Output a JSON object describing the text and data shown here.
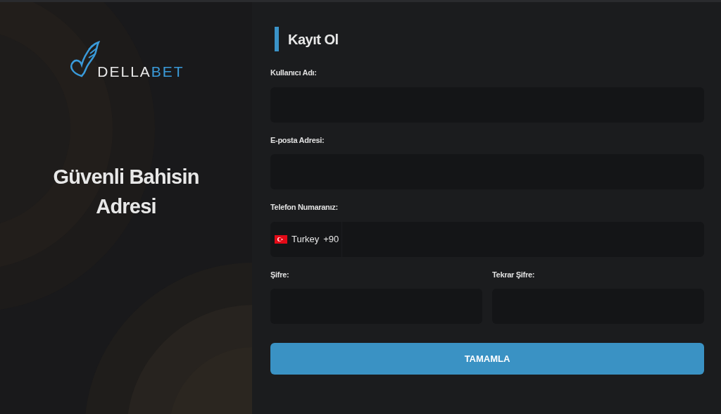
{
  "promo": {
    "logo": [
      "DELLA",
      "BET"
    ],
    "tagline": "Güvenli Bahisin Adresi"
  },
  "form": {
    "title": "Kayıt Ol",
    "rows": [
      {
        "fields": [
          {
            "label": "Kullanıcı Adı:",
            "kind": "text"
          }
        ]
      },
      {
        "fields": [
          {
            "label": "E-posta Adresi:",
            "kind": "text"
          }
        ]
      },
      {
        "fields": [
          {
            "label": "Telefon Numaranız:",
            "kind": "phone",
            "country": "Turkey",
            "code": "+90"
          }
        ]
      },
      {
        "fields": [
          {
            "label": "Şifre:",
            "kind": "password"
          },
          {
            "label": "Tekrar Şifre:",
            "kind": "password"
          }
        ]
      }
    ],
    "submit": "TAMAMLA"
  }
}
